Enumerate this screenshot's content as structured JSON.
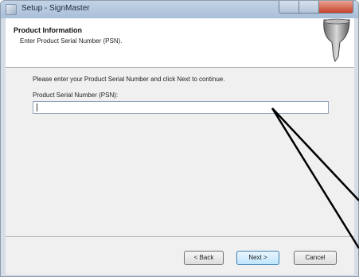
{
  "window": {
    "title": "Setup - SignMaster"
  },
  "header": {
    "title": "Product Information",
    "subtitle": "Enter Product Serial Number (PSN)."
  },
  "main": {
    "instructions": "Please enter your Product Serial Number and click Next to continue.",
    "field_label": "Product Serial Number (PSN):",
    "serial_value": ""
  },
  "buttons": {
    "back": "< Back",
    "next": "Next >",
    "cancel": "Cancel"
  },
  "colors": {
    "client_bg": "#f0f0f0",
    "header_bg": "#ffffff",
    "pointer_lines": "#000000"
  },
  "icons": [
    "app-icon",
    "signmaster-logo-icon"
  ]
}
